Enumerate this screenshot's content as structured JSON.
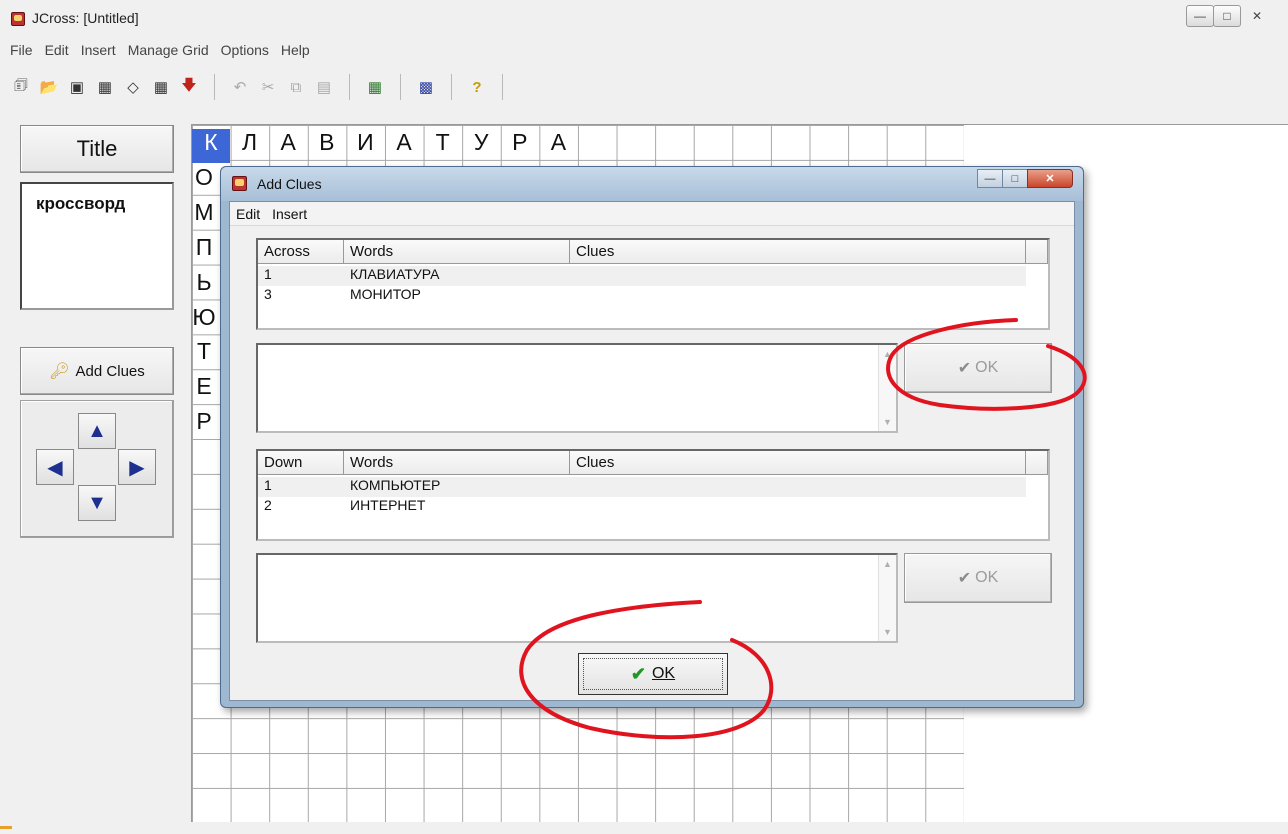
{
  "window": {
    "title": "JCross: [Untitled]"
  },
  "menubar": [
    "File",
    "Edit",
    "Insert",
    "Manage Grid",
    "Options",
    "Help"
  ],
  "left_panel": {
    "title_button": "Title",
    "title_value": "кроссворд",
    "add_clues_button": "Add Clues"
  },
  "grid": {
    "across_word": [
      "К",
      "Л",
      "А",
      "В",
      "И",
      "А",
      "Т",
      "У",
      "Р",
      "А"
    ],
    "down_word": [
      "О",
      "М",
      "П",
      "Ь",
      "Ю",
      "Т",
      "Е",
      "Р"
    ]
  },
  "dialog": {
    "title": "Add Clues",
    "menu": [
      "Edit",
      "Insert"
    ],
    "across": {
      "headers": [
        "Across",
        "Words",
        "Clues"
      ],
      "rows": [
        {
          "num": "1",
          "word": "КЛАВИАТУРА",
          "clue": ""
        },
        {
          "num": "3",
          "word": "МОНИТОР",
          "clue": ""
        }
      ],
      "ok_label": "OK"
    },
    "down": {
      "headers": [
        "Down",
        "Words",
        "Clues"
      ],
      "rows": [
        {
          "num": "1",
          "word": "КОМПЬЮТЕР",
          "clue": ""
        },
        {
          "num": "2",
          "word": "ИНТЕРНЕТ",
          "clue": ""
        }
      ],
      "ok_label": "OK"
    },
    "main_ok_label": "OK"
  },
  "annotations": {
    "circle_color": "#e0141e"
  }
}
